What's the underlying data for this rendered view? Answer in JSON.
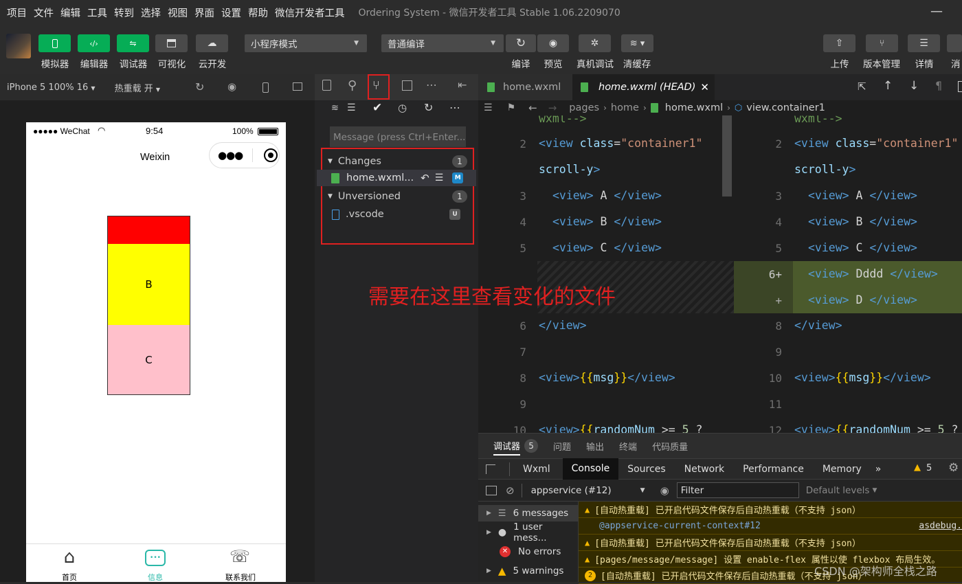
{
  "menubar": {
    "items": [
      "项目",
      "文件",
      "编辑",
      "工具",
      "转到",
      "选择",
      "视图",
      "界面",
      "设置",
      "帮助",
      "微信开发者工具"
    ],
    "window_title": "Ordering System - 微信开发者工具 Stable 1.06.2209070"
  },
  "toolbar": {
    "simulator": "模拟器",
    "editor": "编辑器",
    "debugger": "调试器",
    "visual": "可视化",
    "cloud": "云开发",
    "mode_select": "小程序模式",
    "compile_select": "普通编译",
    "compile": "编译",
    "preview": "预览",
    "real_debug": "真机调试",
    "clear_cache": "清缓存",
    "upload": "上传",
    "version": "版本管理",
    "details": "详情",
    "more": "消"
  },
  "simbar": {
    "device": "iPhone 5 100% 16",
    "hot_reload": "热重载 开"
  },
  "phone": {
    "signal": "●●●●● WeChat",
    "time": "9:54",
    "battery": "100%",
    "nav_title": "Weixin",
    "box_b": "B",
    "box_c": "C",
    "tabs": [
      "首页",
      "信息",
      "联系我们"
    ]
  },
  "git": {
    "message_placeholder": "Message (press Ctrl+Enter...",
    "changes_label": "Changes",
    "changes_count": "1",
    "changed_file": "home.wxml...",
    "changed_badge": "M",
    "unversioned_label": "Unversioned",
    "unversioned_count": "1",
    "unversioned_file": ".vscode",
    "unversioned_badge": "U",
    "annotation": "需要在这里查看变化的文件"
  },
  "editor": {
    "tab1": "home.wxml",
    "tab2": "home.wxml (HEAD)",
    "breadcrumb": [
      "pages",
      "home",
      "home.wxml",
      "view.container1"
    ]
  },
  "devtools": {
    "top_tabs": [
      "调试器",
      "问题",
      "输出",
      "终端",
      "代码质量"
    ],
    "debugger_count": "5",
    "tabs": [
      "Wxml",
      "Console",
      "Sources",
      "Network",
      "Performance",
      "Memory"
    ],
    "warn_count": "5",
    "context": "appservice (#12)",
    "filter_placeholder": "Filter",
    "levels": "Default levels",
    "sidebar": [
      "6 messages",
      "1 user mess...",
      "No errors",
      "5 warnings"
    ],
    "log": [
      "[自动热重载] 已开启代码文件保存后自动热重载（不支持 json）",
      "@appservice-current-context#12",
      "asdebug.",
      "[自动热重载] 已开启代码文件保存后自动热重载（不支持 json）",
      "[pages/message/message] 设置 enable-flex 属性以使 flexbox 布局生效。",
      "[自动热重载] 已开启代码文件保存后自动热重载（不支持 json）"
    ],
    "watermark": "CSDN @架构师全栈之路"
  },
  "colors": {
    "green": "#06ad56",
    "red_highlight": "#e02020",
    "box_red": "#ff0000",
    "box_yellow": "#ffff00",
    "box_pink": "#ffc0cb",
    "diff_added": "#4b5a2c"
  }
}
